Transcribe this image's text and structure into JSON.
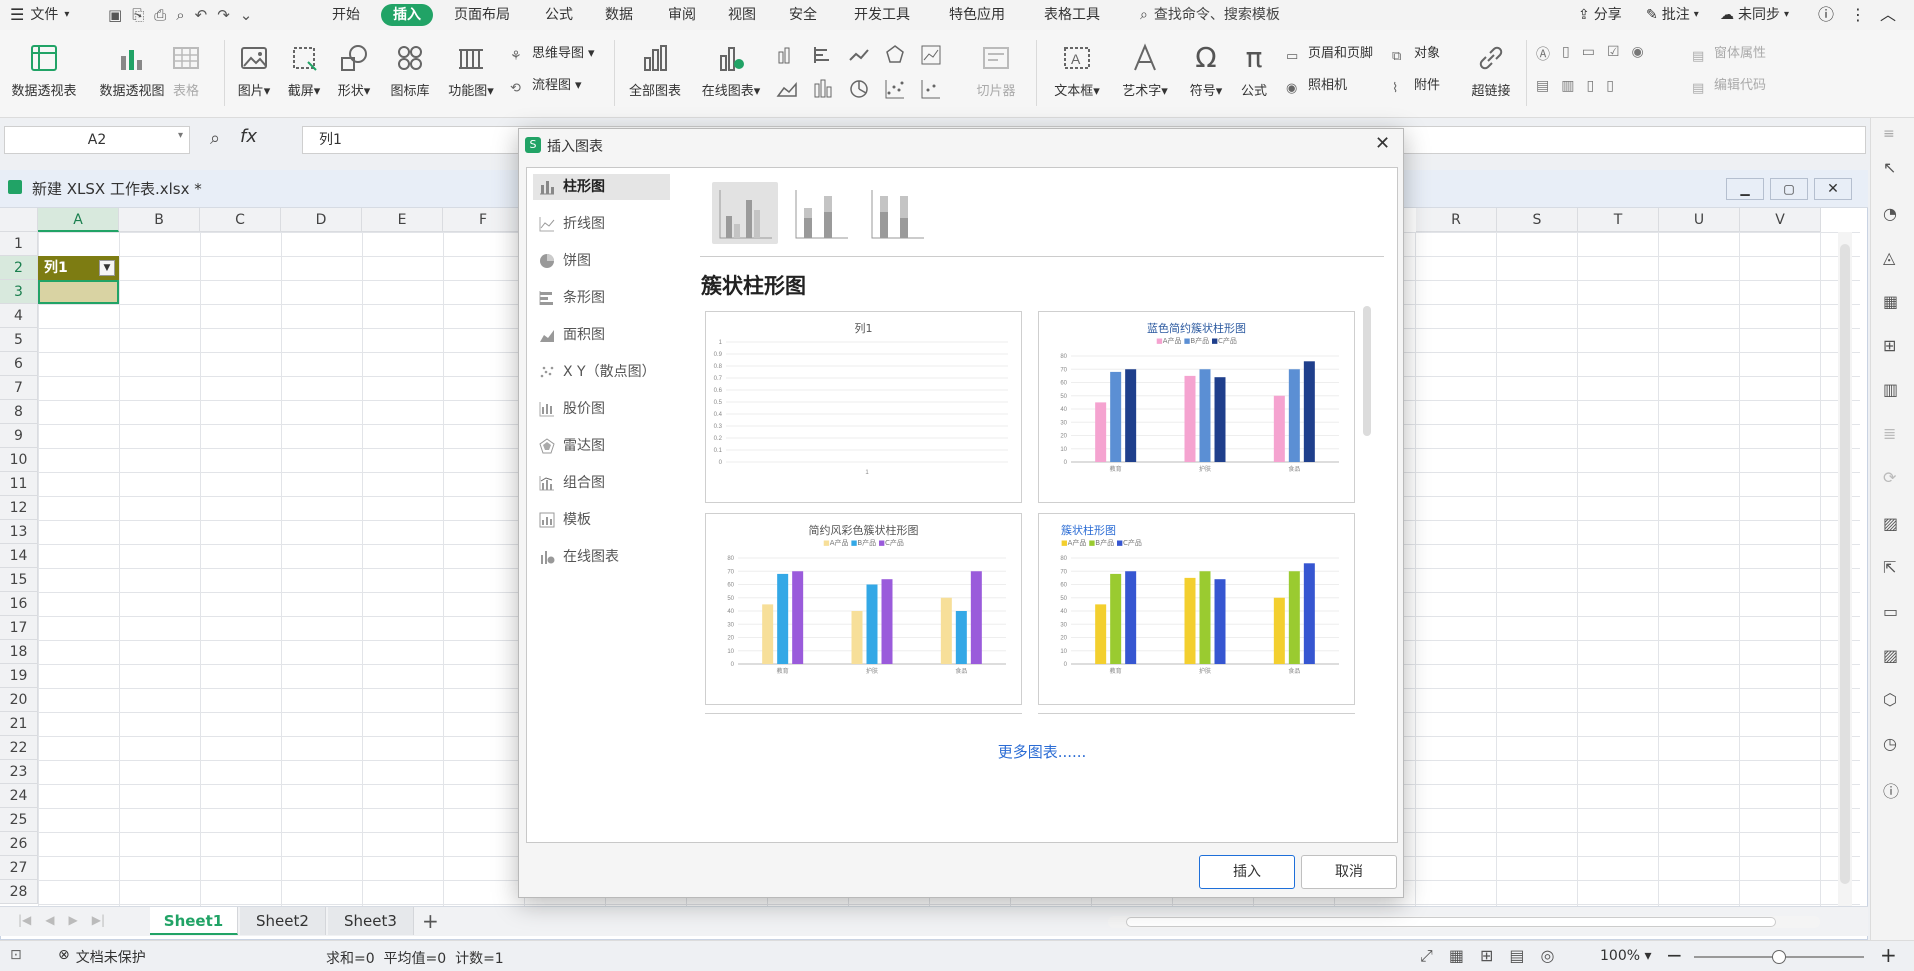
{
  "menubar": {
    "file_label": "文件",
    "tabs": [
      "开始",
      "插入",
      "页面布局",
      "公式",
      "数据",
      "审阅",
      "视图",
      "安全",
      "开发工具",
      "特色应用",
      "表格工具"
    ],
    "active_tab": "插入",
    "search_placeholder": "查找命令、搜索模板",
    "share": "分享",
    "comment": "批注",
    "sync": "未同步"
  },
  "ribbon": {
    "pivot_table": "数据透视表",
    "pivot_chart": "数据透视图",
    "table": "表格",
    "picture": "图片",
    "screenshot": "截屏",
    "shape": "形状",
    "icon_lib": "图标库",
    "func_chart": "功能图",
    "mindmap": "思维导图",
    "flowchart": "流程图",
    "all_charts": "全部图表",
    "online_charts": "在线图表",
    "slicer": "切片器",
    "textbox": "文本框",
    "wordart": "艺术字",
    "symbol": "符号",
    "formula": "公式",
    "header_footer": "页眉和页脚",
    "object": "对象",
    "camera": "照相机",
    "attachment": "附件",
    "hyperlink": "超链接",
    "window_props": "窗体属性",
    "edit_code": "编辑代码"
  },
  "formulabar": {
    "cell_ref": "A2",
    "fx": "fx",
    "content": "列1"
  },
  "workbook": {
    "title": "新建 XLSX 工作表.xlsx *",
    "columns_left": [
      "A",
      "B",
      "C",
      "D",
      "E",
      "F"
    ],
    "columns_right": [
      "R",
      "S",
      "T",
      "U",
      "V"
    ],
    "rows": [
      "1",
      "2",
      "3",
      "4",
      "5",
      "6",
      "7",
      "8",
      "9",
      "10",
      "11",
      "12",
      "13",
      "14",
      "15",
      "16",
      "17",
      "18",
      "19",
      "20",
      "21",
      "22",
      "23",
      "24",
      "25",
      "26",
      "27",
      "28"
    ],
    "cell_a2": "列1",
    "sheets": [
      "Sheet1",
      "Sheet2",
      "Sheet3"
    ],
    "add_sheet": "+"
  },
  "status": {
    "protect": "文档未保护",
    "summary": "求和=0  平均值=0  计数=1",
    "zoom": "100%",
    "zoom_level": 0.5
  },
  "dialog": {
    "title": "插入图表",
    "categories": [
      "柱形图",
      "折线图",
      "饼图",
      "条形图",
      "面积图",
      "X Y（散点图）",
      "股价图",
      "雷达图",
      "组合图",
      "模板",
      "在线图表"
    ],
    "active_category": "柱形图",
    "section_title": "簇状柱形图",
    "more_charts": "更多图表......",
    "insert": "插入",
    "cancel": "取消",
    "cards": [
      {
        "title": "列1",
        "yticks": [
          "1",
          "0.9",
          "0.8",
          "0.7",
          "0.6",
          "0.5",
          "0.4",
          "0.3",
          "0.2",
          "0.1",
          "0"
        ],
        "xtick": "1"
      },
      {
        "title": "蓝色简约簇状柱形图",
        "legend": [
          "A产品",
          "B产品",
          "C产品"
        ],
        "categories": [
          "教育",
          "护肤",
          "食品"
        ],
        "yticks": [
          "80",
          "70",
          "60",
          "50",
          "40",
          "30",
          "20",
          "10",
          "0"
        ],
        "colors": [
          "#f5a3d0",
          "#5b8fd4",
          "#1f3f8c"
        ],
        "values": [
          [
            45,
            68,
            70
          ],
          [
            65,
            70,
            64
          ],
          [
            50,
            70,
            76
          ]
        ]
      },
      {
        "title": "简约风彩色簇状柱形图",
        "legend": [
          "A产品",
          "B产品",
          "C产品"
        ],
        "categories": [
          "教育",
          "护肤",
          "食品"
        ],
        "yticks": [
          "80",
          "70",
          "60",
          "50",
          "40",
          "30",
          "20",
          "10",
          "0"
        ],
        "colors": [
          "#f7df99",
          "#33a8e6",
          "#9a5bdb"
        ],
        "values": [
          [
            45,
            68,
            70
          ],
          [
            40,
            60,
            64
          ],
          [
            50,
            40,
            70
          ]
        ]
      },
      {
        "title": "簇状柱形图",
        "legend": [
          "A产品",
          "B产品",
          "C产品"
        ],
        "categories": [
          "教育",
          "护肤",
          "食品"
        ],
        "yticks": [
          "80",
          "70",
          "60",
          "50",
          "40",
          "30",
          "20",
          "10",
          "0"
        ],
        "colors": [
          "#f3cf2e",
          "#9acb30",
          "#3656d1"
        ],
        "values": [
          [
            45,
            68,
            70
          ],
          [
            65,
            70,
            64
          ],
          [
            50,
            70,
            76
          ]
        ]
      }
    ]
  }
}
